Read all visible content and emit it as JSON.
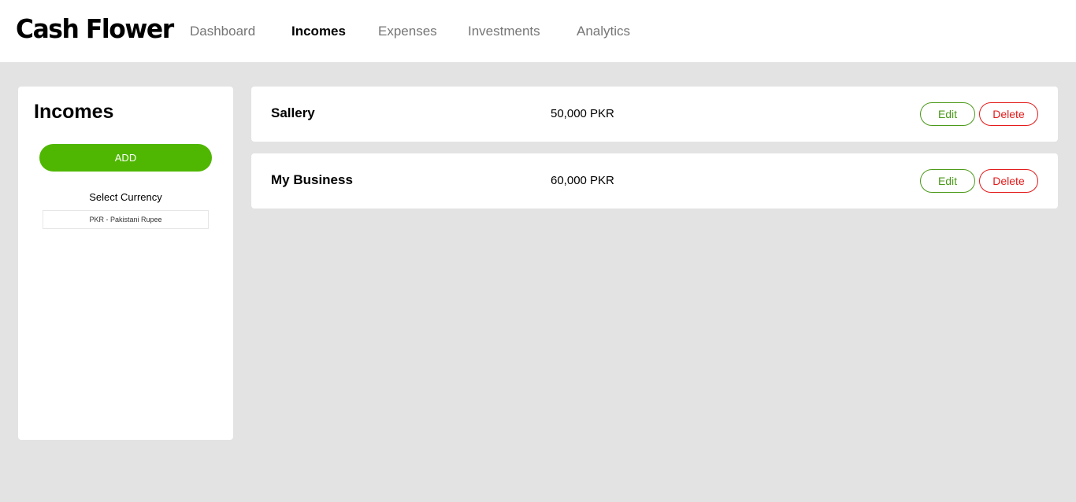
{
  "app": {
    "logo": "Cash Flower"
  },
  "nav": {
    "items": [
      {
        "label": "Dashboard",
        "active": false
      },
      {
        "label": "Incomes",
        "active": true
      },
      {
        "label": "Expenses",
        "active": false
      },
      {
        "label": "Investments",
        "active": false
      },
      {
        "label": "Analytics",
        "active": false
      }
    ]
  },
  "sidebar": {
    "title": "Incomes",
    "add_label": "ADD",
    "currency_label": "Select Currency",
    "currency_value": "PKR - Pakistani Rupee"
  },
  "incomes": [
    {
      "name": "Sallery",
      "amount": "50,000 PKR",
      "edit_label": "Edit",
      "delete_label": "Delete"
    },
    {
      "name": "My Business",
      "amount": "60,000 PKR",
      "edit_label": "Edit",
      "delete_label": "Delete"
    }
  ],
  "colors": {
    "background": "#e3e3e3",
    "accent_green": "#4fb701",
    "edit_green": "#4c9a1a",
    "delete_red": "#e31b1b"
  }
}
